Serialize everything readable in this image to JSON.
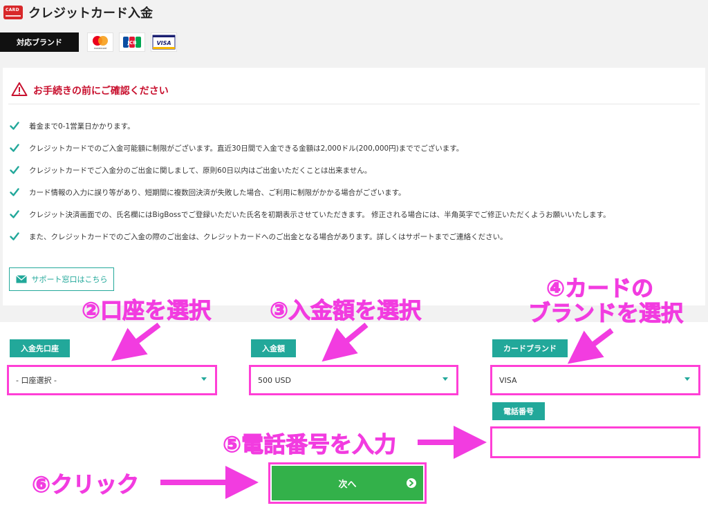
{
  "header": {
    "card_icon_text": "CARD",
    "title": "クレジットカード入金"
  },
  "brands": {
    "label": "対応ブランド",
    "logos": [
      {
        "name": "mastercard",
        "text": "mastercard"
      },
      {
        "name": "jcb",
        "text": "JCB"
      },
      {
        "name": "visa",
        "text": "VISA"
      }
    ]
  },
  "notice": {
    "heading": "お手続きの前にご確認ください",
    "items": [
      "着金まで0-1営業日かかります。",
      "クレジットカードでのご入金可能額に制限がございます。直近30日間で入金できる金額は2,000ドル(200,000円)まででございます。",
      "クレジットカードでご入金分のご出金に関しまして、原則60日以内はご出金いただくことは出来ません。",
      "カード情報の入力に誤り等があり、短期間に複数回決済が失敗した場合、ご利用に制限がかかる場合がございます。",
      "クレジット決済画面での、氏名欄にはBigBossでご登録いただいた氏名を初期表示させていただきます。 修正される場合には、半角英字でご修正いただくようお願いいたします。",
      "また、クレジットカードでのご入金の際のご出金は、クレジットカードへのご出金となる場合があります。詳しくはサポートまでご連絡ください。"
    ],
    "support_button": "サポート窓口はこちら"
  },
  "form": {
    "account": {
      "label": "入金先口座",
      "value": "- 口座選択 -"
    },
    "amount": {
      "label": "入金額",
      "value": "500 USD"
    },
    "brand": {
      "label": "カードブランド",
      "value": "VISA"
    },
    "phone": {
      "label": "電話番号",
      "value": ""
    },
    "next_button": "次へ"
  },
  "annotations": {
    "step2": "②口座を選択",
    "step3": "③入金額を選択",
    "step4_line1": "④カードの",
    "step4_line2": "ブランドを選択",
    "step5": "⑤電話番号を入力",
    "step6": "⑥クリック"
  },
  "colors": {
    "teal": "#22a89a",
    "warning_red": "#c8102e",
    "annotation_pink": "#ff3fd6",
    "button_green": "#33b14a"
  }
}
